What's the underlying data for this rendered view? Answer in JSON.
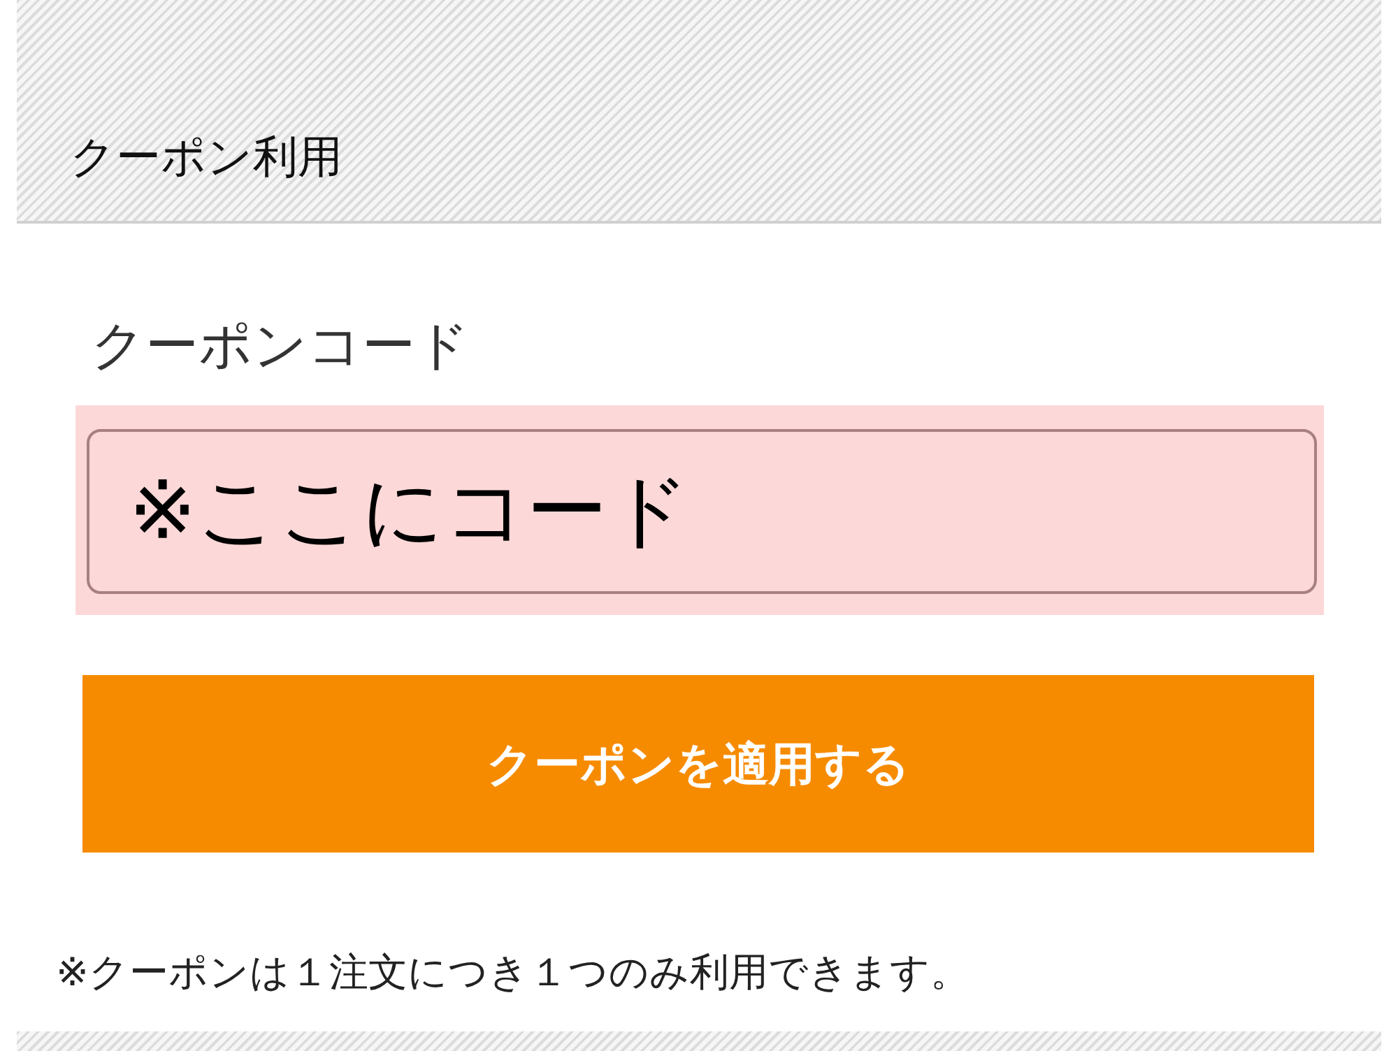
{
  "header": {
    "title": "クーポン利用"
  },
  "coupon_field": {
    "label": "クーポンコード",
    "value": "※ここにコード"
  },
  "apply_button": {
    "label": "クーポンを適用する"
  },
  "note": "※クーポンは１注文につき１つのみ利用できます。"
}
